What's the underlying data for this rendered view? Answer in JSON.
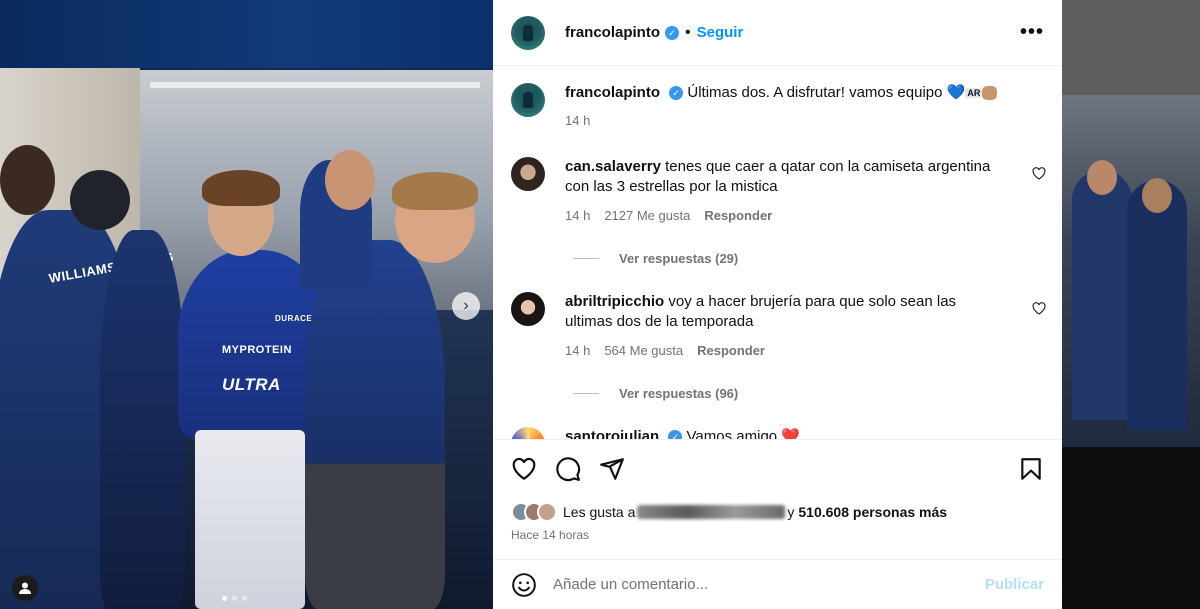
{
  "post": {
    "username": "francolapinto",
    "follow_label": "Seguir",
    "more_label": "•••",
    "caption": {
      "username": "francolapinto",
      "text": "Últimas dos. A disfrutar! vamos equipo",
      "emoji_heart": "💙",
      "emoji_flag": "AR",
      "time": "14 h"
    },
    "comments": [
      {
        "username": "can.salaverry",
        "text": "tenes que caer a qatar con la camiseta argentina con las 3 estrellas por la mistica",
        "time": "14 h",
        "likes": "2127 Me gusta",
        "reply_label": "Responder",
        "view_replies": "Ver respuestas (29)"
      },
      {
        "username": "abriltripicchio",
        "text": "voy a hacer brujería para que solo sean las ultimas dos de la temporada",
        "time": "14 h",
        "likes": "564 Me gusta",
        "reply_label": "Responder",
        "view_replies": "Ver respuestas (96)"
      },
      {
        "username": "santoroiulian",
        "text": "Vamos amigo",
        "emoji": "❤️"
      }
    ],
    "likes": {
      "prefix": "Les gusta a",
      "connector": "y",
      "count": "510.608 personas más"
    },
    "time_ago": "Hace 14 horas",
    "add_comment": {
      "placeholder": "Añade un comentario...",
      "publish_label": "Publicar"
    }
  },
  "photo": {
    "suit_team": "WILLIAMS RACING",
    "suit_sponsor": "ULTRA",
    "suit_sponsor2": "MYPROTEIN",
    "suit_sponsor3": "DURACELL",
    "carousel_dots": 3,
    "carousel_active": 1
  }
}
